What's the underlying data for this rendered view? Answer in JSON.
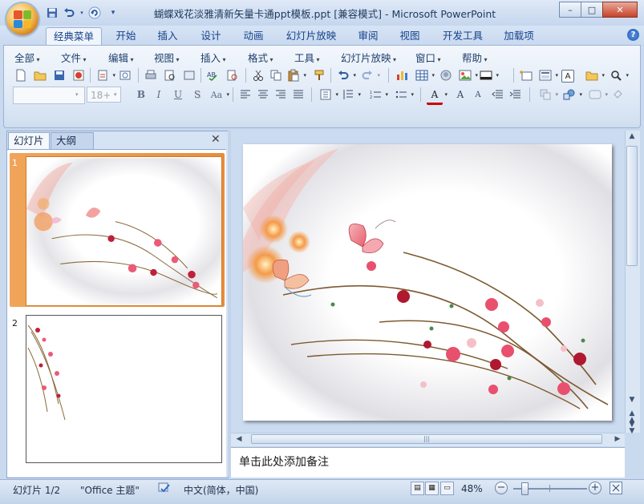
{
  "window": {
    "title": "蝴蝶戏花淡雅清新矢量卡通ppt模板.ppt [兼容模式] - Microsoft PowerPoint",
    "min_label": "–",
    "max_label": "□",
    "close_label": "✕"
  },
  "quick_access": [
    "save-icon",
    "undo-icon",
    "redo-icon",
    "customize-icon"
  ],
  "ribbon_tabs": [
    {
      "label": "经典菜单",
      "active": true
    },
    {
      "label": "开始"
    },
    {
      "label": "插入"
    },
    {
      "label": "设计"
    },
    {
      "label": "动画"
    },
    {
      "label": "幻灯片放映"
    },
    {
      "label": "审阅"
    },
    {
      "label": "视图"
    },
    {
      "label": "开发工具"
    },
    {
      "label": "加载项"
    }
  ],
  "help_label": "?",
  "menu": [
    "全部",
    "文件",
    "编辑",
    "视图",
    "插入",
    "格式",
    "工具",
    "幻灯片放映",
    "窗口",
    "帮助"
  ],
  "font": {
    "name": "",
    "size": "18+"
  },
  "format_buttons": {
    "bold": "B",
    "italic": "I",
    "underline": "U",
    "shadow": "S",
    "case": "Aa",
    "font_color": "A",
    "grow": "A",
    "shrink": "A"
  },
  "side_pane": {
    "tabs": [
      "幻灯片",
      "大纲"
    ],
    "close_label": "✕",
    "slides": [
      {
        "number": "1",
        "selected": true
      },
      {
        "number": "2",
        "selected": false
      }
    ]
  },
  "notes_placeholder": "单击此处添加备注",
  "status": {
    "slide_info": "幻灯片 1/2",
    "theme": "\"Office 主题\"",
    "language": "中文(简体，中国)",
    "zoom": "48%",
    "zoom_fraction": 0.16
  },
  "colors": {
    "accent": "#f0a55a",
    "ribbon": "#dde8f6",
    "frame": "#c9d9ee"
  }
}
